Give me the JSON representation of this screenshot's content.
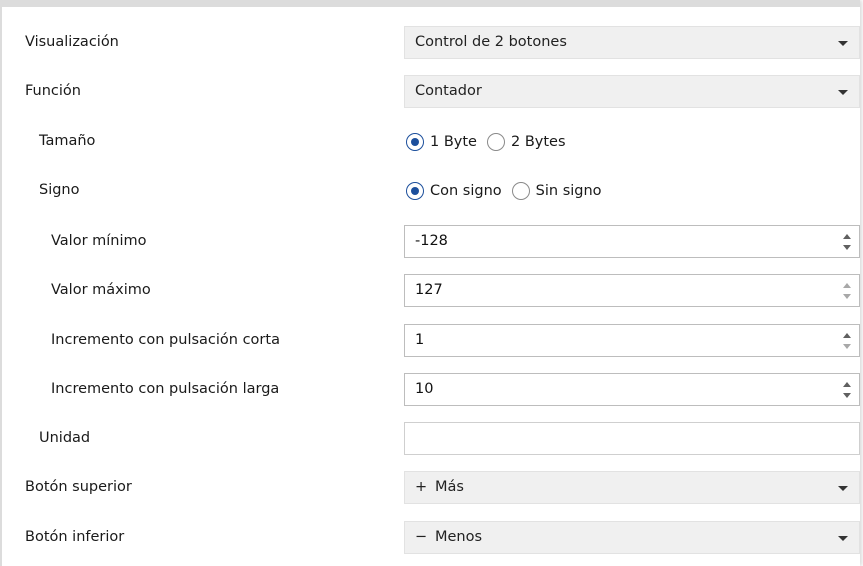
{
  "fields": {
    "visualizacion": {
      "label": "Visualización",
      "value": "Control de 2 botones"
    },
    "funcion": {
      "label": "Función",
      "value": "Contador"
    },
    "tamano": {
      "label": "Tamaño",
      "options": [
        "1 Byte",
        "2 Bytes"
      ],
      "selected": "1 Byte"
    },
    "signo": {
      "label": "Signo",
      "options": [
        "Con signo",
        "Sin signo"
      ],
      "selected": "Con signo"
    },
    "valor_minimo": {
      "label": "Valor mínimo",
      "value": "-128"
    },
    "valor_maximo": {
      "label": "Valor máximo",
      "value": "127"
    },
    "incremento_corta": {
      "label": "Incremento con pulsación corta",
      "value": "1"
    },
    "incremento_larga": {
      "label": "Incremento con pulsación larga",
      "value": "10"
    },
    "unidad": {
      "label": "Unidad",
      "value": ""
    },
    "boton_superior": {
      "label": "Botón superior",
      "symbol": "+",
      "value": "Más"
    },
    "boton_inferior": {
      "label": "Botón inferior",
      "symbol": "−",
      "value": "Menos"
    }
  },
  "colors": {
    "radio_selected": "#1c4f9c",
    "dropdown_bg": "#f0f0f0"
  },
  "icons": {
    "dropdown": "chevron-down-icon",
    "spinner": "spin-arrows-icon"
  }
}
